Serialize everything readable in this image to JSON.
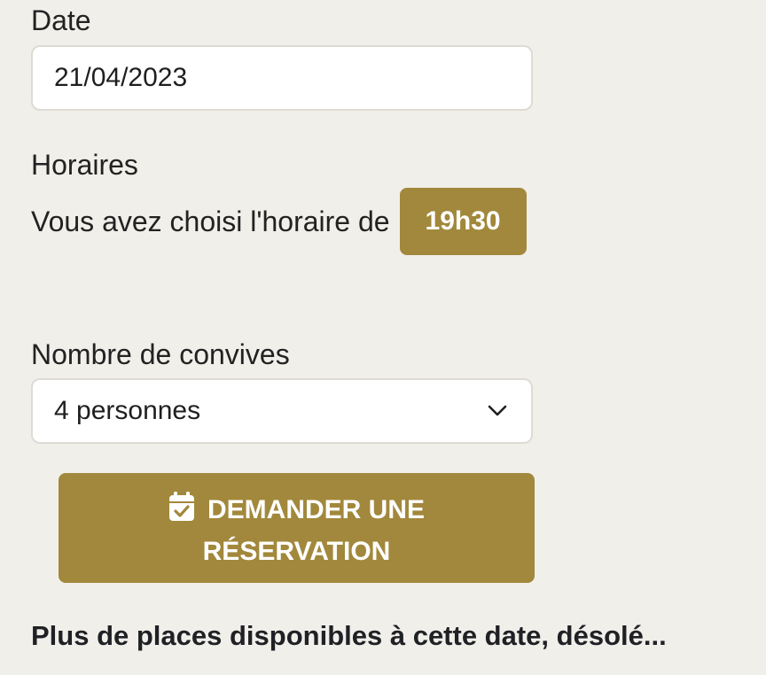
{
  "date": {
    "label": "Date",
    "value": "21/04/2023"
  },
  "schedule": {
    "label": "Horaires",
    "chosen_text": "Vous avez choisi l'horaire de",
    "chosen_time": "19h30"
  },
  "guests": {
    "label": "Nombre de convives",
    "selected": "4 personnes"
  },
  "reserve_button": {
    "line1": "DEMANDER UNE",
    "line2": "RÉSERVATION",
    "icon": "calendar-check-icon"
  },
  "notice": "Plus de places disponibles à cette date, désolé...",
  "colors": {
    "accent": "#a2883c",
    "background": "#f1efea",
    "text": "#222222"
  }
}
